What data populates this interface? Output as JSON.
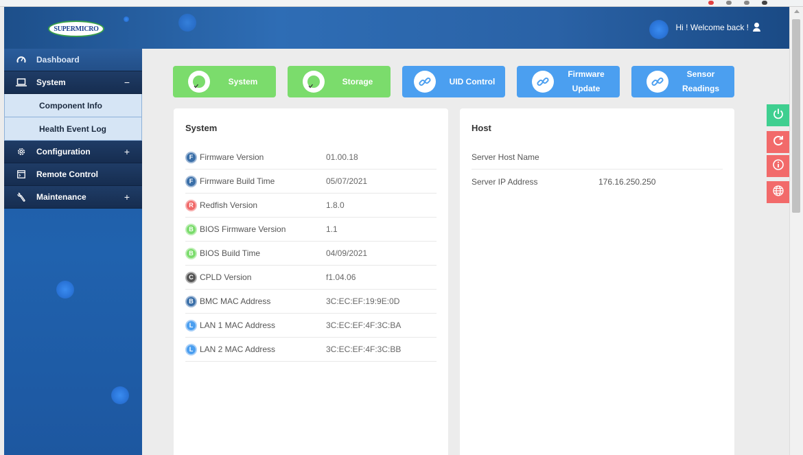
{
  "header": {
    "logo_text": "SUPERMICRO",
    "welcome": "Hi ! Welcome back !"
  },
  "sidebar": {
    "items": [
      {
        "label": "Dashboard",
        "icon": "gauge-icon"
      },
      {
        "label": "System",
        "icon": "laptop-icon",
        "toggle": "−"
      },
      {
        "label": "Component Info"
      },
      {
        "label": "Health Event Log"
      },
      {
        "label": "Configuration",
        "icon": "gear-icon",
        "toggle": "+"
      },
      {
        "label": "Remote Control",
        "icon": "console-icon"
      },
      {
        "label": "Maintenance",
        "icon": "wrench-icon",
        "toggle": "+"
      }
    ]
  },
  "quick_buttons": [
    {
      "label": "System",
      "color": "#7bdc6c",
      "icon": "check-icon"
    },
    {
      "label": "Storage",
      "color": "#7bdc6c",
      "icon": "check-icon"
    },
    {
      "label": "UID Control",
      "color": "#4b9ff0",
      "icon": "link-icon"
    },
    {
      "label": "Firmware Update",
      "color": "#4b9ff0",
      "icon": "link-icon"
    },
    {
      "label": "Sensor Readings",
      "color": "#4b9ff0",
      "icon": "link-icon"
    }
  ],
  "system_card": {
    "title": "System",
    "rows": [
      {
        "label": "Firmware Version",
        "value": "01.00.18",
        "badge": "F",
        "badge_color": "#3a6fa8"
      },
      {
        "label": "Firmware Build Time",
        "value": "05/07/2021",
        "badge": "F",
        "badge_color": "#3a6fa8"
      },
      {
        "label": "Redfish Version",
        "value": "1.8.0",
        "badge": "R",
        "badge_color": "#f06868"
      },
      {
        "label": "BIOS Firmware Version",
        "value": "1.1",
        "badge": "B",
        "badge_color": "#7bdc6c"
      },
      {
        "label": "BIOS Build Time",
        "value": "04/09/2021",
        "badge": "B",
        "badge_color": "#7bdc6c"
      },
      {
        "label": "CPLD Version",
        "value": "f1.04.06",
        "badge": "C",
        "badge_color": "#555555"
      },
      {
        "label": "BMC MAC Address",
        "value": "3C:EC:EF:19:9E:0D",
        "badge": "B",
        "badge_color": "#3a6fa8"
      },
      {
        "label": "LAN 1 MAC Address",
        "value": "3C:EC:EF:4F:3C:BA",
        "badge": "L",
        "badge_color": "#4b9ff0"
      },
      {
        "label": "LAN 2 MAC Address",
        "value": "3C:EC:EF:4F:3C:BB",
        "badge": "L",
        "badge_color": "#4b9ff0"
      }
    ]
  },
  "host_card": {
    "title": "Host",
    "rows": [
      {
        "label": "Server Host Name",
        "value": ""
      },
      {
        "label": "Server IP Address",
        "value": "176.16.250.250"
      }
    ]
  },
  "actions": [
    {
      "icon": "power-icon",
      "color": "#3fcf90"
    },
    {
      "icon": "refresh-icon",
      "color": "#f26a6a"
    },
    {
      "icon": "info-icon",
      "color": "#f26a6a"
    },
    {
      "icon": "globe-icon",
      "color": "#f26a6a"
    }
  ]
}
